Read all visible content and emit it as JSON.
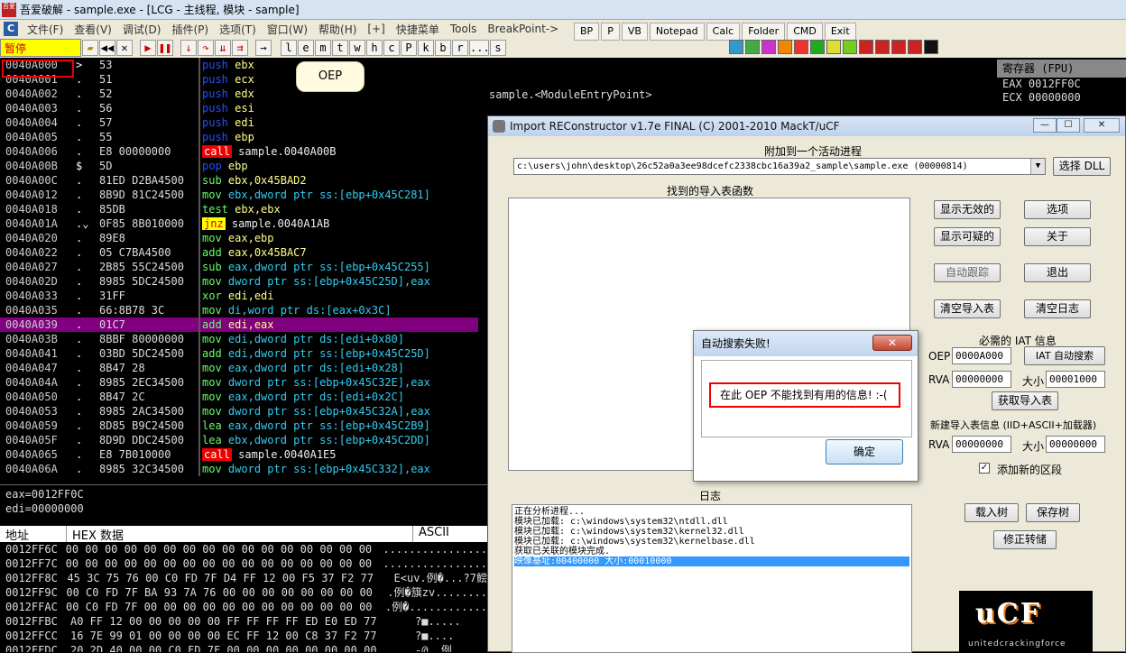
{
  "title": "吾爱破解 - sample.exe - [LCG - 主线程, 模块 - sample]",
  "menu": [
    "文件(F)",
    "查看(V)",
    "调试(D)",
    "插件(P)",
    "选项(T)",
    "窗口(W)",
    "帮助(H)",
    "[+]",
    "快捷菜单",
    "Tools",
    "BreakPoint->"
  ],
  "toolbar": {
    "status": "暂停",
    "letters": [
      "l",
      "e",
      "m",
      "t",
      "w",
      "h",
      "c",
      "P",
      "k",
      "b",
      "r",
      "...",
      "s"
    ]
  },
  "toolbar2": [
    "BP",
    "P",
    "VB",
    "Notepad",
    "Calc",
    "Folder",
    "CMD",
    "Exit"
  ],
  "disasm": [
    {
      "addr": "0040A000",
      "mark": ">",
      "hex": "53",
      "mn": "push",
      "op": "ebx"
    },
    {
      "addr": "0040A001",
      "mark": ".",
      "hex": "51",
      "mn": "push",
      "op": "ecx"
    },
    {
      "addr": "0040A002",
      "mark": ".",
      "hex": "52",
      "mn": "push",
      "op": "edx"
    },
    {
      "addr": "0040A003",
      "mark": ".",
      "hex": "56",
      "mn": "push",
      "op": "esi"
    },
    {
      "addr": "0040A004",
      "mark": ".",
      "hex": "57",
      "mn": "push",
      "op": "edi"
    },
    {
      "addr": "0040A005",
      "mark": ".",
      "hex": "55",
      "mn": "push",
      "op": "ebp"
    },
    {
      "addr": "0040A006",
      "mark": ".",
      "hex": "E8 00000000",
      "mn": "call",
      "op": "sample.0040A00B"
    },
    {
      "addr": "0040A00B",
      "mark": "$",
      "hex": "5D",
      "mn": "pop",
      "op": "ebp"
    },
    {
      "addr": "0040A00C",
      "mark": ".",
      "hex": "81ED D2BA4500",
      "mn": "sub",
      "op": "ebx,0x45BAD2"
    },
    {
      "addr": "0040A012",
      "mark": ".",
      "hex": "8B9D 81C24500",
      "mn": "mov",
      "op": "ebx,dword ptr ss:[ebp+0x45C281]"
    },
    {
      "addr": "0040A018",
      "mark": ".",
      "hex": "85DB",
      "mn": "test",
      "op": "ebx,ebx"
    },
    {
      "addr": "0040A01A",
      "mark": ".⌄",
      "hex": "0F85 8B010000",
      "mn": "jnz",
      "op": "sample.0040A1AB"
    },
    {
      "addr": "0040A020",
      "mark": ".",
      "hex": "89E8",
      "mn": "mov",
      "op": "eax,ebp"
    },
    {
      "addr": "0040A022",
      "mark": ".",
      "hex": "05 C7BA4500",
      "mn": "add",
      "op": "eax,0x45BAC7"
    },
    {
      "addr": "0040A027",
      "mark": ".",
      "hex": "2B85 55C24500",
      "mn": "sub",
      "op": "eax,dword ptr ss:[ebp+0x45C255]"
    },
    {
      "addr": "0040A02D",
      "mark": ".",
      "hex": "8985 5DC24500",
      "mn": "mov",
      "op": "dword ptr ss:[ebp+0x45C25D],eax"
    },
    {
      "addr": "0040A033",
      "mark": ".",
      "hex": "31FF",
      "mn": "xor",
      "op": "edi,edi"
    },
    {
      "addr": "0040A035",
      "mark": ".",
      "hex": "66:8B78 3C",
      "mn": "mov",
      "op": "di,word ptr ds:[eax+0x3C]"
    },
    {
      "addr": "0040A039",
      "mark": ".",
      "hex": "01C7",
      "mn": "add",
      "op": "edi,eax"
    },
    {
      "addr": "0040A03B",
      "mark": ".",
      "hex": "8BBF 80000000",
      "mn": "mov",
      "op": "edi,dword ptr ds:[edi+0x80]"
    },
    {
      "addr": "0040A041",
      "mark": ".",
      "hex": "03BD 5DC24500",
      "mn": "add",
      "op": "edi,dword ptr ss:[ebp+0x45C25D]"
    },
    {
      "addr": "0040A047",
      "mark": ".",
      "hex": "8B47 28",
      "mn": "mov",
      "op": "eax,dword ptr ds:[edi+0x28]"
    },
    {
      "addr": "0040A04A",
      "mark": ".",
      "hex": "8985 2EC34500",
      "mn": "mov",
      "op": "dword ptr ss:[ebp+0x45C32E],eax"
    },
    {
      "addr": "0040A050",
      "mark": ".",
      "hex": "8B47 2C",
      "mn": "mov",
      "op": "eax,dword ptr ds:[edi+0x2C]"
    },
    {
      "addr": "0040A053",
      "mark": ".",
      "hex": "8985 2AC34500",
      "mn": "mov",
      "op": "dword ptr ss:[ebp+0x45C32A],eax"
    },
    {
      "addr": "0040A059",
      "mark": ".",
      "hex": "8D85 B9C24500",
      "mn": "lea",
      "op": "eax,dword ptr ss:[ebp+0x45C2B9]"
    },
    {
      "addr": "0040A05F",
      "mark": ".",
      "hex": "8D9D DDC24500",
      "mn": "lea",
      "op": "ebx,dword ptr ss:[ebp+0x45C2DD]"
    },
    {
      "addr": "0040A065",
      "mark": ".",
      "hex": "E8 7B010000",
      "mn": "call",
      "op": "sample.0040A1E5"
    },
    {
      "addr": "0040A06A",
      "mark": ".",
      "hex": "8985 32C34500",
      "mn": "mov",
      "op": "dword ptr ss:[ebp+0x45C332],eax"
    }
  ],
  "oep_note": "OEP",
  "entry": "sample.<ModuleEntryPoint>",
  "regs": {
    "head": "寄存器 (FPU)",
    "lines": [
      "EAX 0012FF0C",
      "ECX 00000000"
    ]
  },
  "status_lines": [
    "eax=0012FF0C",
    "edi=00000000"
  ],
  "dump_head": {
    "addr": "地址",
    "hex": "HEX 数据",
    "ascii": "ASCII"
  },
  "dump": [
    {
      "addr": "0012FF6C",
      "hex": "00 00 00 00 00 00 00 00 00 00 00 00 00 00 00 00",
      "asc": "................"
    },
    {
      "addr": "0012FF7C",
      "hex": "00 00 00 00 00 00 00 00 00 00 00 00 00 00 00 00",
      "asc": "................"
    },
    {
      "addr": "0012FF8C",
      "hex": "45 3C 75 76 00 C0 FD 7F D4 FF 12 00 F5 37 F2 77",
      "asc": "E<uv.例�...?7鲿"
    },
    {
      "addr": "0012FF9C",
      "hex": "00 C0 FD 7F BA 93 7A 76 00 00 00 00 00 00 00 00",
      "asc": ".例�簱zv........"
    },
    {
      "addr": "0012FFAC",
      "hex": "00 C0 FD 7F 00 00 00 00 00 00 00 00 00 00 00 00",
      "asc": ".例�............"
    },
    {
      "addr": "0012FFBC",
      "hex": "A0 FF 12 00 00 00 00 00 FF FF FF FF ED E0 ED 77",
      "asc": "?■.....        "
    },
    {
      "addr": "0012FFCC",
      "hex": "16 7E 99 01 00 00 00 00 EC FF 12 00 C8 37 F2 77",
      "asc": "?■....          "
    },
    {
      "addr": "0012FFDC",
      "hex": "20 2D 40 00 00 C0 FD 7F 00 00 00 00 00 00 00 00",
      "asc": " -@..例...."
    }
  ],
  "irec": {
    "title": "Import REConstructor v1.7e FINAL (C) 2001-2010 MackT/uCF",
    "attach_label": "附加到一个活动进程",
    "process": "c:\\users\\john\\desktop\\26c52a0a3ee98dcefc2338cbc16a39a2_sample\\sample.exe (00000814)",
    "select_dll": "选择 DLL",
    "imports_label": "找到的导入表函数",
    "btn_invalid": "显示无效的",
    "btn_suspect": "显示可疑的",
    "btn_autotrace": "自动跟踪",
    "btn_clear_imports": "清空导入表",
    "btn_options": "选项",
    "btn_about": "关于",
    "btn_exit": "退出",
    "btn_clear_log": "清空日志",
    "iat_info": "必需的 IAT 信息",
    "oep_label": "OEP",
    "oep_value": "0000A000",
    "iat_autosearch": "IAT 自动搜索",
    "rva_label": "RVA",
    "rva_value": "00000000",
    "size_label": "大小",
    "size_value": "00001000",
    "get_imports": "获取导入表",
    "new_import_info": "新建导入表信息 (IID+ASCII+加载器)",
    "rva2_value": "00000000",
    "size2_value": "00000000",
    "add_section": "添加新的区段",
    "log_label": "日志",
    "log": [
      "正在分析进程...",
      "模块已加载: c:\\windows\\system32\\ntdll.dll",
      "模块已加载: c:\\windows\\system32\\kernel32.dll",
      "模块已加载: c:\\windows\\system32\\kernelbase.dll",
      "获取已关联的模块完成.",
      "映像基址:00400000 大小:00010000"
    ],
    "btn_loadtree": "载入树",
    "btn_savetree": "保存树",
    "btn_fixdump": "修正转储",
    "ucf_sub": "unitedcrackingforce"
  },
  "dialog": {
    "title": "自动搜索失败!",
    "close": "✕",
    "message": "在此 OEP 不能找到有用的信息! :-(",
    "ok": "确定"
  }
}
